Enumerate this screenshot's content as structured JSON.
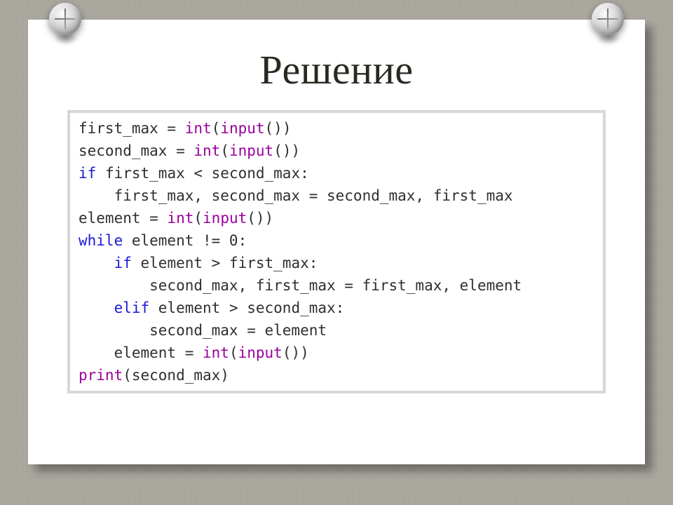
{
  "title": "Решение",
  "code": {
    "l1a": "first_max = ",
    "l1b": "int",
    "l1c": "(",
    "l1d": "input",
    "l1e": "())",
    "l2a": "second_max = ",
    "l2b": "int",
    "l2c": "(",
    "l2d": "input",
    "l2e": "())",
    "l3a": "if",
    "l3b": " first_max < second_max:",
    "l4": "    first_max, second_max = second_max, first_max",
    "l5a": "element = ",
    "l5b": "int",
    "l5c": "(",
    "l5d": "input",
    "l5e": "())",
    "l6a": "while",
    "l6b": " element != 0:",
    "l7a": "    ",
    "l7b": "if",
    "l7c": " element > first_max:",
    "l8": "        second_max, first_max = first_max, element",
    "l9a": "    ",
    "l9b": "elif",
    "l9c": " element > second_max:",
    "l10": "        second_max = element",
    "l11a": "    element = ",
    "l11b": "int",
    "l11c": "(",
    "l11d": "input",
    "l11e": "())",
    "l12a": "print",
    "l12b": "(second_max)"
  }
}
